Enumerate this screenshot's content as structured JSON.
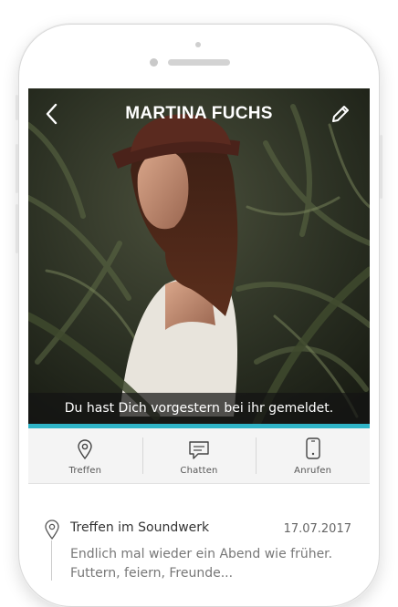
{
  "header": {
    "name": "MARTINA FUCHS",
    "back_icon": "chevron-left-icon",
    "edit_icon": "pencil-icon"
  },
  "status": {
    "text": "Du hast Dich vorgestern bei ihr gemeldet."
  },
  "actions": [
    {
      "label": "Treffen",
      "icon": "map-pin-icon"
    },
    {
      "label": "Chatten",
      "icon": "chat-bubble-icon"
    },
    {
      "label": "Anrufen",
      "icon": "smartphone-icon"
    }
  ],
  "timeline": {
    "items": [
      {
        "title": "Treffen im Soundwerk",
        "date": "17.07.2017",
        "text_line1": "Endlich mal wieder ein Abend wie früher.",
        "text_line2": "Futtern, feiern, Freunde..."
      }
    ]
  },
  "colors": {
    "accent": "#2fb4c7",
    "name_text": "#ffffff",
    "status_bg": "#141414"
  }
}
